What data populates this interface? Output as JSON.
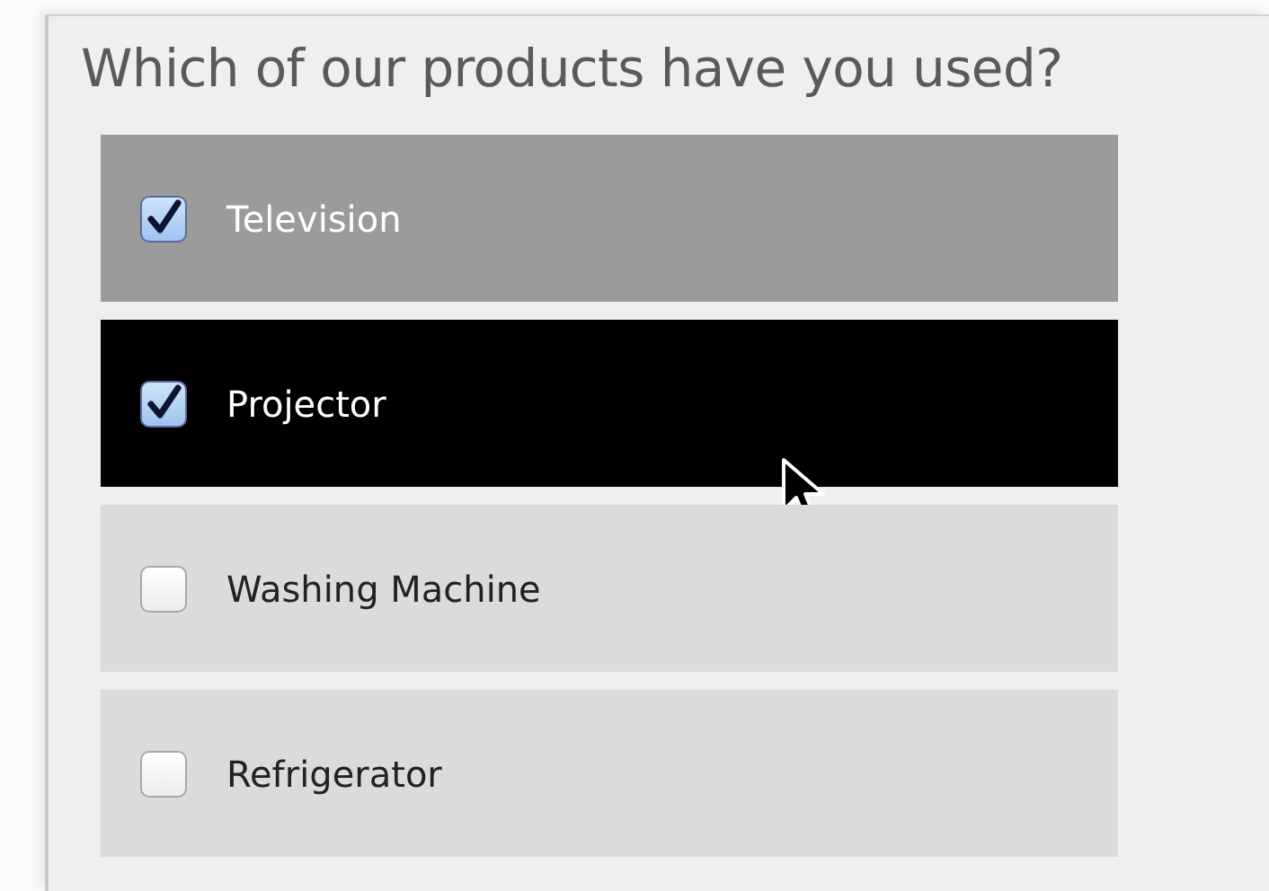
{
  "question": "Which of our products have you used?",
  "options": [
    {
      "label": "Television",
      "checked": true,
      "hovered": false
    },
    {
      "label": "Projector",
      "checked": true,
      "hovered": true
    },
    {
      "label": "Washing Machine",
      "checked": false,
      "hovered": false
    },
    {
      "label": "Refrigerator",
      "checked": false,
      "hovered": false
    }
  ]
}
